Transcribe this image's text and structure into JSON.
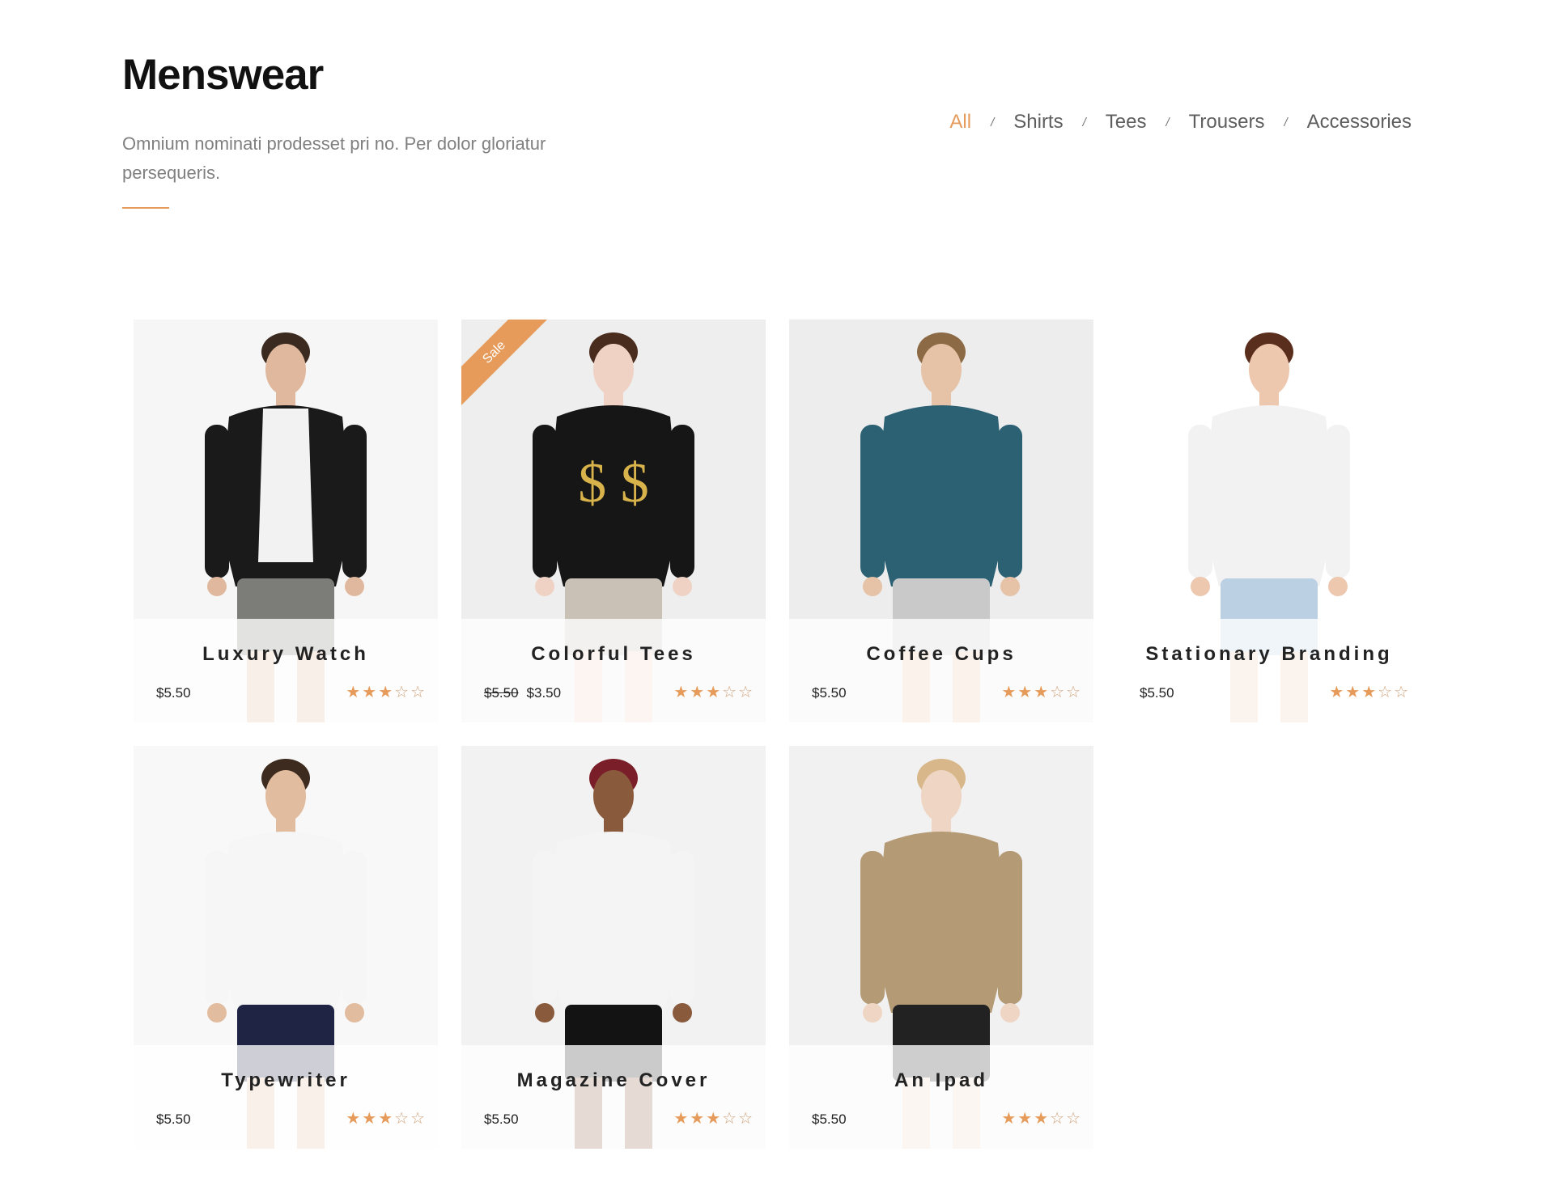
{
  "header": {
    "title": "Menswear",
    "description": "Omnium nominati prodesset pri no. Per dolor gloriatur persequeris."
  },
  "filters": [
    {
      "label": "All",
      "active": true
    },
    {
      "label": "Shirts",
      "active": false
    },
    {
      "label": "Tees",
      "active": false
    },
    {
      "label": "Trousers",
      "active": false
    },
    {
      "label": "Accessories",
      "active": false
    }
  ],
  "filter_separator": "/",
  "accent_color": "#e69b5b",
  "products": [
    {
      "name": "Luxury Watch",
      "price": "$5.50",
      "old_price": "",
      "rating": 3,
      "badge": ""
    },
    {
      "name": "Colorful Tees",
      "price": "$3.50",
      "old_price": "$5.50",
      "rating": 3,
      "badge": "Sale"
    },
    {
      "name": "Coffee Cups",
      "price": "$5.50",
      "old_price": "",
      "rating": 3,
      "badge": ""
    },
    {
      "name": "Stationary Branding",
      "price": "$5.50",
      "old_price": "",
      "rating": 3,
      "badge": ""
    },
    {
      "name": "Typewriter",
      "price": "$5.50",
      "old_price": "",
      "rating": 3,
      "badge": ""
    },
    {
      "name": "Magazine Cover",
      "price": "$5.50",
      "old_price": "",
      "rating": 3,
      "badge": ""
    },
    {
      "name": "An Ipad",
      "price": "$5.50",
      "old_price": "",
      "rating": 3,
      "badge": ""
    }
  ],
  "rating_max": 5
}
